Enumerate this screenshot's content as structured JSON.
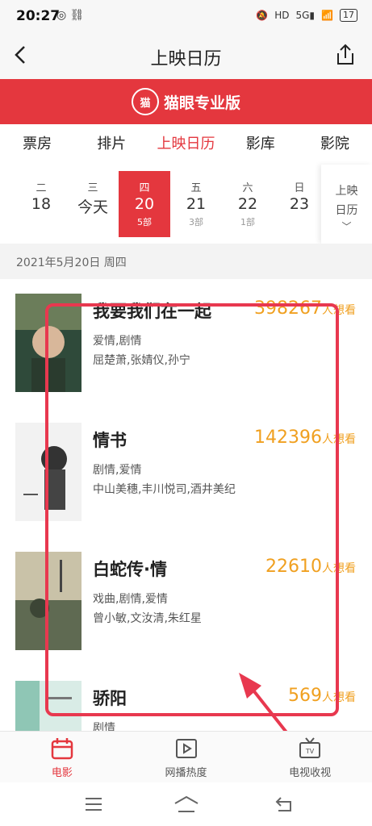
{
  "status": {
    "time": "20:27",
    "battery": "17"
  },
  "nav": {
    "title": "上映日历"
  },
  "banner": {
    "text": "猫眼专业版",
    "logo": "猫"
  },
  "tabs": [
    {
      "label": "票房"
    },
    {
      "label": "排片"
    },
    {
      "label": "上映日历"
    },
    {
      "label": "影库"
    },
    {
      "label": "影院"
    }
  ],
  "dates": [
    {
      "weekday": "二",
      "day": "18",
      "count": ""
    },
    {
      "weekday": "三",
      "day": "今天",
      "count": ""
    },
    {
      "weekday": "四",
      "day": "20",
      "count": "5部"
    },
    {
      "weekday": "五",
      "day": "21",
      "count": "3部"
    },
    {
      "weekday": "六",
      "day": "22",
      "count": "1部"
    },
    {
      "weekday": "日",
      "day": "23",
      "count": ""
    }
  ],
  "calendar_button": {
    "line1": "上映",
    "line2": "日历"
  },
  "date_header": "2021年5月20日 周四",
  "movies": [
    {
      "name": "我要我们在一起",
      "genre": "爱情,剧情",
      "cast": "屈楚萧,张婧仪,孙宁",
      "want": "398267",
      "want_unit": "人想看"
    },
    {
      "name": "情书",
      "genre": "剧情,爱情",
      "cast": "中山美穗,丰川悦司,酒井美纪",
      "want": "142396",
      "want_unit": "人想看"
    },
    {
      "name": "白蛇传·情",
      "genre": "戏曲,剧情,爱情",
      "cast": "曾小敏,文汝清,朱红星",
      "want": "22610",
      "want_unit": "人想看"
    },
    {
      "name": "骄阳",
      "genre": "剧情",
      "cast": "",
      "want": "569",
      "want_unit": "人想看"
    }
  ],
  "bottom_nav": [
    {
      "label": "电影"
    },
    {
      "label": "网播热度"
    },
    {
      "label": "电视收视"
    }
  ],
  "colors": {
    "accent": "#e4373e",
    "want": "#f0a020",
    "annotation": "#e8384f"
  }
}
